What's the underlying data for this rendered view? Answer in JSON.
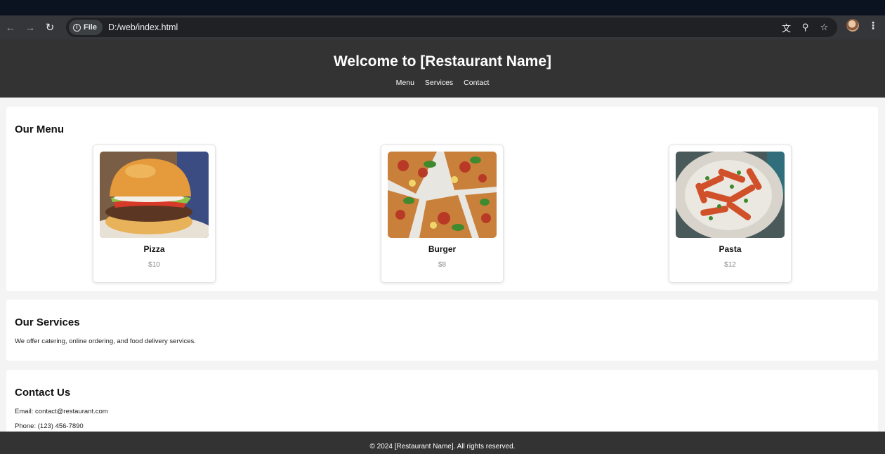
{
  "browser": {
    "chip_label": "File",
    "url": "D:/web/index.html",
    "icons": [
      "back-arrow-icon",
      "forward-arrow-icon",
      "reload-icon",
      "info-icon",
      "translate-icon",
      "zoom-icon",
      "star-icon",
      "profile-avatar",
      "kebab-menu-icon"
    ]
  },
  "header": {
    "title": "Welcome to [Restaurant Name]",
    "nav": [
      "Menu",
      "Services",
      "Contact"
    ]
  },
  "menu": {
    "heading": "Our Menu",
    "items": [
      {
        "name": "Pizza",
        "price": "$10",
        "image": "burger-photo"
      },
      {
        "name": "Burger",
        "price": "$8",
        "image": "pizza-photo"
      },
      {
        "name": "Pasta",
        "price": "$12",
        "image": "pasta-photo"
      }
    ]
  },
  "services": {
    "heading": "Our Services",
    "text": "We offer catering, online ordering, and food delivery services."
  },
  "contact": {
    "heading": "Contact Us",
    "email": "Email: contact@restaurant.com",
    "phone": "Phone: (123) 456-7890"
  },
  "footer": {
    "text": "© 2024 [Restaurant Name]. All rights reserved."
  },
  "colors": {
    "header_bg": "#333333",
    "page_bg": "#f4f4f4",
    "browser_toolbar": "#35363a",
    "omnibox": "#202124"
  }
}
